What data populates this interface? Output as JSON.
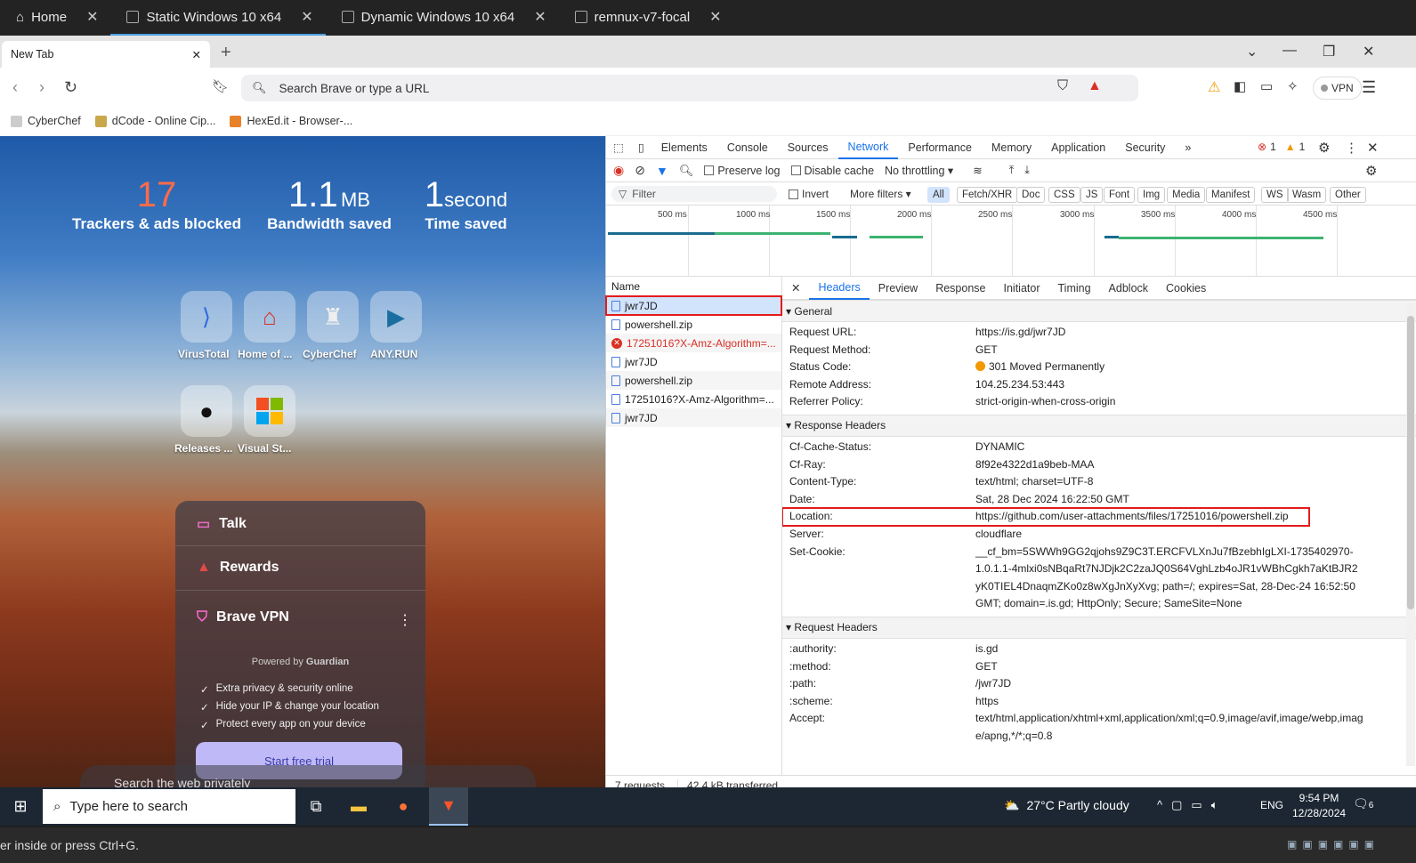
{
  "vm_tabs": [
    {
      "label": "Home",
      "icon": "home-icon"
    },
    {
      "label": "Static Windows 10 x64",
      "icon": "vm-icon"
    },
    {
      "label": "Dynamic Windows 10 x64",
      "icon": "vm-icon"
    },
    {
      "label": "remnux-v7-focal",
      "icon": "vm-icon"
    }
  ],
  "browser": {
    "tab_title": "New Tab",
    "url_placeholder": "Search Brave or type a URL",
    "vpn_label": "VPN",
    "bookmarks": [
      "CyberChef",
      "dCode - Online Cip...",
      "HexEd.it - Browser-..."
    ]
  },
  "ntp": {
    "stats": [
      {
        "num": "17",
        "unit": "",
        "label": "Trackers & ads blocked"
      },
      {
        "num": "1.1",
        "unit": "MB",
        "label": "Bandwidth saved"
      },
      {
        "num": "1",
        "unit": "second",
        "label": "Time saved"
      }
    ],
    "tiles": [
      "VirusTotal",
      "Home of ...",
      "CyberChef",
      "ANY.RUN",
      "Releases ...",
      "Visual St..."
    ],
    "talk": "Talk",
    "rewards": "Rewards",
    "vpn_title": "Brave VPN",
    "powered_by": "Powered by",
    "guardian": "Guardian",
    "features": [
      "Extra privacy & security online",
      "Hide your IP & change your location",
      "Protect every app on your device"
    ],
    "trial_btn": "Start free trial",
    "search_placeholder": "Search the web privately"
  },
  "devtools": {
    "tabs": [
      "Elements",
      "Console",
      "Sources",
      "Network",
      "Performance",
      "Memory",
      "Application",
      "Security"
    ],
    "errors": "1",
    "warnings": "1",
    "preserve_log": "Preserve log",
    "disable_cache": "Disable cache",
    "throttling": "No throttling",
    "filter_placeholder": "Filter",
    "invert": "Invert",
    "more_filters": "More filters",
    "chips": [
      "All",
      "Fetch/XHR",
      "Doc",
      "CSS",
      "JS",
      "Font",
      "Img",
      "Media",
      "Manifest",
      "WS",
      "Wasm",
      "Other"
    ],
    "ticks": [
      "500 ms",
      "1000 ms",
      "1500 ms",
      "2000 ms",
      "2500 ms",
      "3000 ms",
      "3500 ms",
      "4000 ms",
      "4500 ms"
    ],
    "name_header": "Name",
    "requests": [
      {
        "name": "jwr7JD",
        "error": false
      },
      {
        "name": "powershell.zip",
        "error": false
      },
      {
        "name": "17251016?X-Amz-Algorithm=...",
        "error": true
      },
      {
        "name": "jwr7JD",
        "error": false
      },
      {
        "name": "powershell.zip",
        "error": false
      },
      {
        "name": "17251016?X-Amz-Algorithm=...",
        "error": false
      },
      {
        "name": "jwr7JD",
        "error": false
      }
    ],
    "footer_requests": "7 requests",
    "footer_transferred": "42.4 kB transferred",
    "detail_tabs": [
      "Headers",
      "Preview",
      "Response",
      "Initiator",
      "Timing",
      "Adblock",
      "Cookies"
    ],
    "general_title": "General",
    "general": [
      {
        "k": "Request URL:",
        "v": "https://is.gd/jwr7JD"
      },
      {
        "k": "Request Method:",
        "v": "GET"
      },
      {
        "k": "Status Code:",
        "v": "301 Moved Permanently"
      },
      {
        "k": "Remote Address:",
        "v": "104.25.234.53:443"
      },
      {
        "k": "Referrer Policy:",
        "v": "strict-origin-when-cross-origin"
      }
    ],
    "response_title": "Response Headers",
    "response": [
      {
        "k": "Cf-Cache-Status:",
        "v": "DYNAMIC"
      },
      {
        "k": "Cf-Ray:",
        "v": "8f92e4322d1a9beb-MAA"
      },
      {
        "k": "Content-Type:",
        "v": "text/html; charset=UTF-8"
      },
      {
        "k": "Date:",
        "v": "Sat, 28 Dec 2024 16:22:50 GMT"
      },
      {
        "k": "Location:",
        "v": "https://github.com/user-attachments/files/17251016/powershell.zip"
      },
      {
        "k": "Server:",
        "v": "cloudflare"
      },
      {
        "k": "Set-Cookie:",
        "v": "__cf_bm=5SWWh9GG2qjohs9Z9C3T.ERCFVLXnJu7fBzebhIgLXI-1735402970-1.0.1.1-4mlxi0sNBqaRt7NJDjk2C2zaJQ0S64VghLzb4oJR1vWBhCgkh7aKtBJR2yK0TIEL4DnaqmZKo0z8wXgJnXyXvg; path=/; expires=Sat, 28-Dec-24 16:52:50 GMT; domain=.is.gd; HttpOnly; Secure; SameSite=None"
      }
    ],
    "request_title": "Request Headers",
    "request": [
      {
        "k": ":authority:",
        "v": "is.gd"
      },
      {
        "k": ":method:",
        "v": "GET"
      },
      {
        "k": ":path:",
        "v": "/jwr7JD"
      },
      {
        "k": ":scheme:",
        "v": "https"
      },
      {
        "k": "Accept:",
        "v": "text/html,application/xhtml+xml,application/xml;q=0.9,image/avif,image/webp,image/apng,*/*;q=0.8"
      }
    ]
  },
  "taskbar": {
    "search_placeholder": "Type here to search",
    "weather": "27°C  Partly cloudy",
    "lang": "ENG",
    "time": "9:54 PM",
    "date": "12/28/2024",
    "notif": "6"
  },
  "status_text": "er inside or press Ctrl+G.",
  "colors": {
    "accent": "#1a73e8",
    "error": "#d93025",
    "highlight": "#e31b1b",
    "status_dot": "#f29900"
  }
}
